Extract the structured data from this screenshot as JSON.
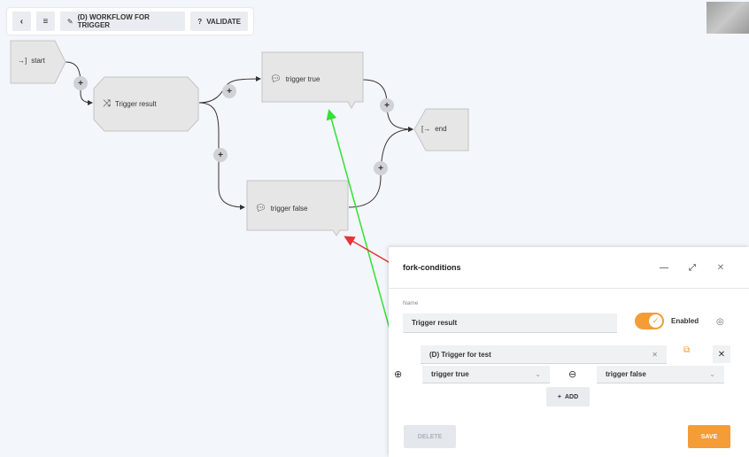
{
  "toolbar": {
    "back_icon": "chevron-left-icon",
    "menu_icon": "hamburger-icon",
    "workflow_label": "(D) WORKFLOW FOR TRIGGER",
    "validate_label": "VALIDATE"
  },
  "flow": {
    "start_label": "start",
    "trigger_result_label": "Trigger result",
    "trigger_true_label": "trigger true",
    "trigger_false_label": "trigger false",
    "end_label": "end",
    "plus_symbol": "+"
  },
  "panel": {
    "title": "fork-conditions",
    "name_label": "Name",
    "name_value": "Trigger result",
    "enabled_label": "Enabled",
    "trigger_select_value": "(D) Trigger for test",
    "true_branch_value": "trigger true",
    "false_branch_value": "trigger false",
    "add_label": "ADD",
    "delete_label": "DELETE",
    "save_label": "SAVE"
  },
  "colors": {
    "accent": "#f39c38",
    "highlight_box": "#e0348c",
    "arrow_green": "#33e033",
    "arrow_red": "#e8333a"
  }
}
